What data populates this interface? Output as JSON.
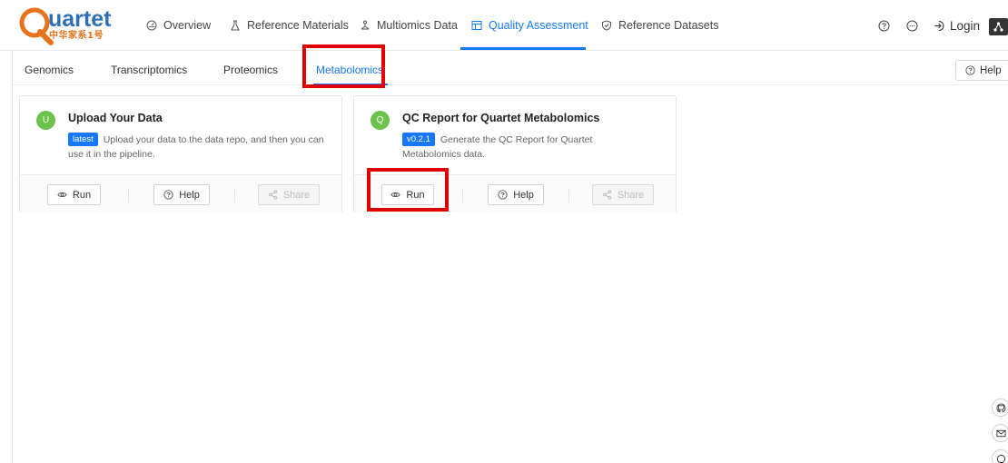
{
  "brand": {
    "name": "uartet",
    "subtitle": "中华家系1号"
  },
  "nav": {
    "items": [
      {
        "label": "Overview"
      },
      {
        "label": "Reference Materials"
      },
      {
        "label": "Multiomics Data"
      },
      {
        "label": "Quality Assessment"
      },
      {
        "label": "Reference Datasets"
      }
    ],
    "login_label": "Login"
  },
  "subtabs": {
    "items": [
      "Genomics",
      "Transcriptomics",
      "Proteomics",
      "Metabolomics"
    ],
    "help_label": "Help"
  },
  "cards": [
    {
      "avatar": "U",
      "title": "Upload Your Data",
      "tag": "latest",
      "description": "Upload your data to the data repo, and then you can use it in the pipeline.",
      "run_label": "Run",
      "help_label": "Help",
      "share_label": "Share"
    },
    {
      "avatar": "Q",
      "title": "QC Report for Quartet Metabolomics",
      "tag": "v0.2.1",
      "description": "Generate the QC Report for Quartet Metabolomics data.",
      "run_label": "Run",
      "help_label": "Help",
      "share_label": "Share"
    }
  ],
  "colors": {
    "accent": "#1677ff",
    "avatar": "#6cc24a",
    "highlight": "#e00000",
    "brand_blue": "#2f6fb3",
    "brand_orange": "#e8731a"
  }
}
